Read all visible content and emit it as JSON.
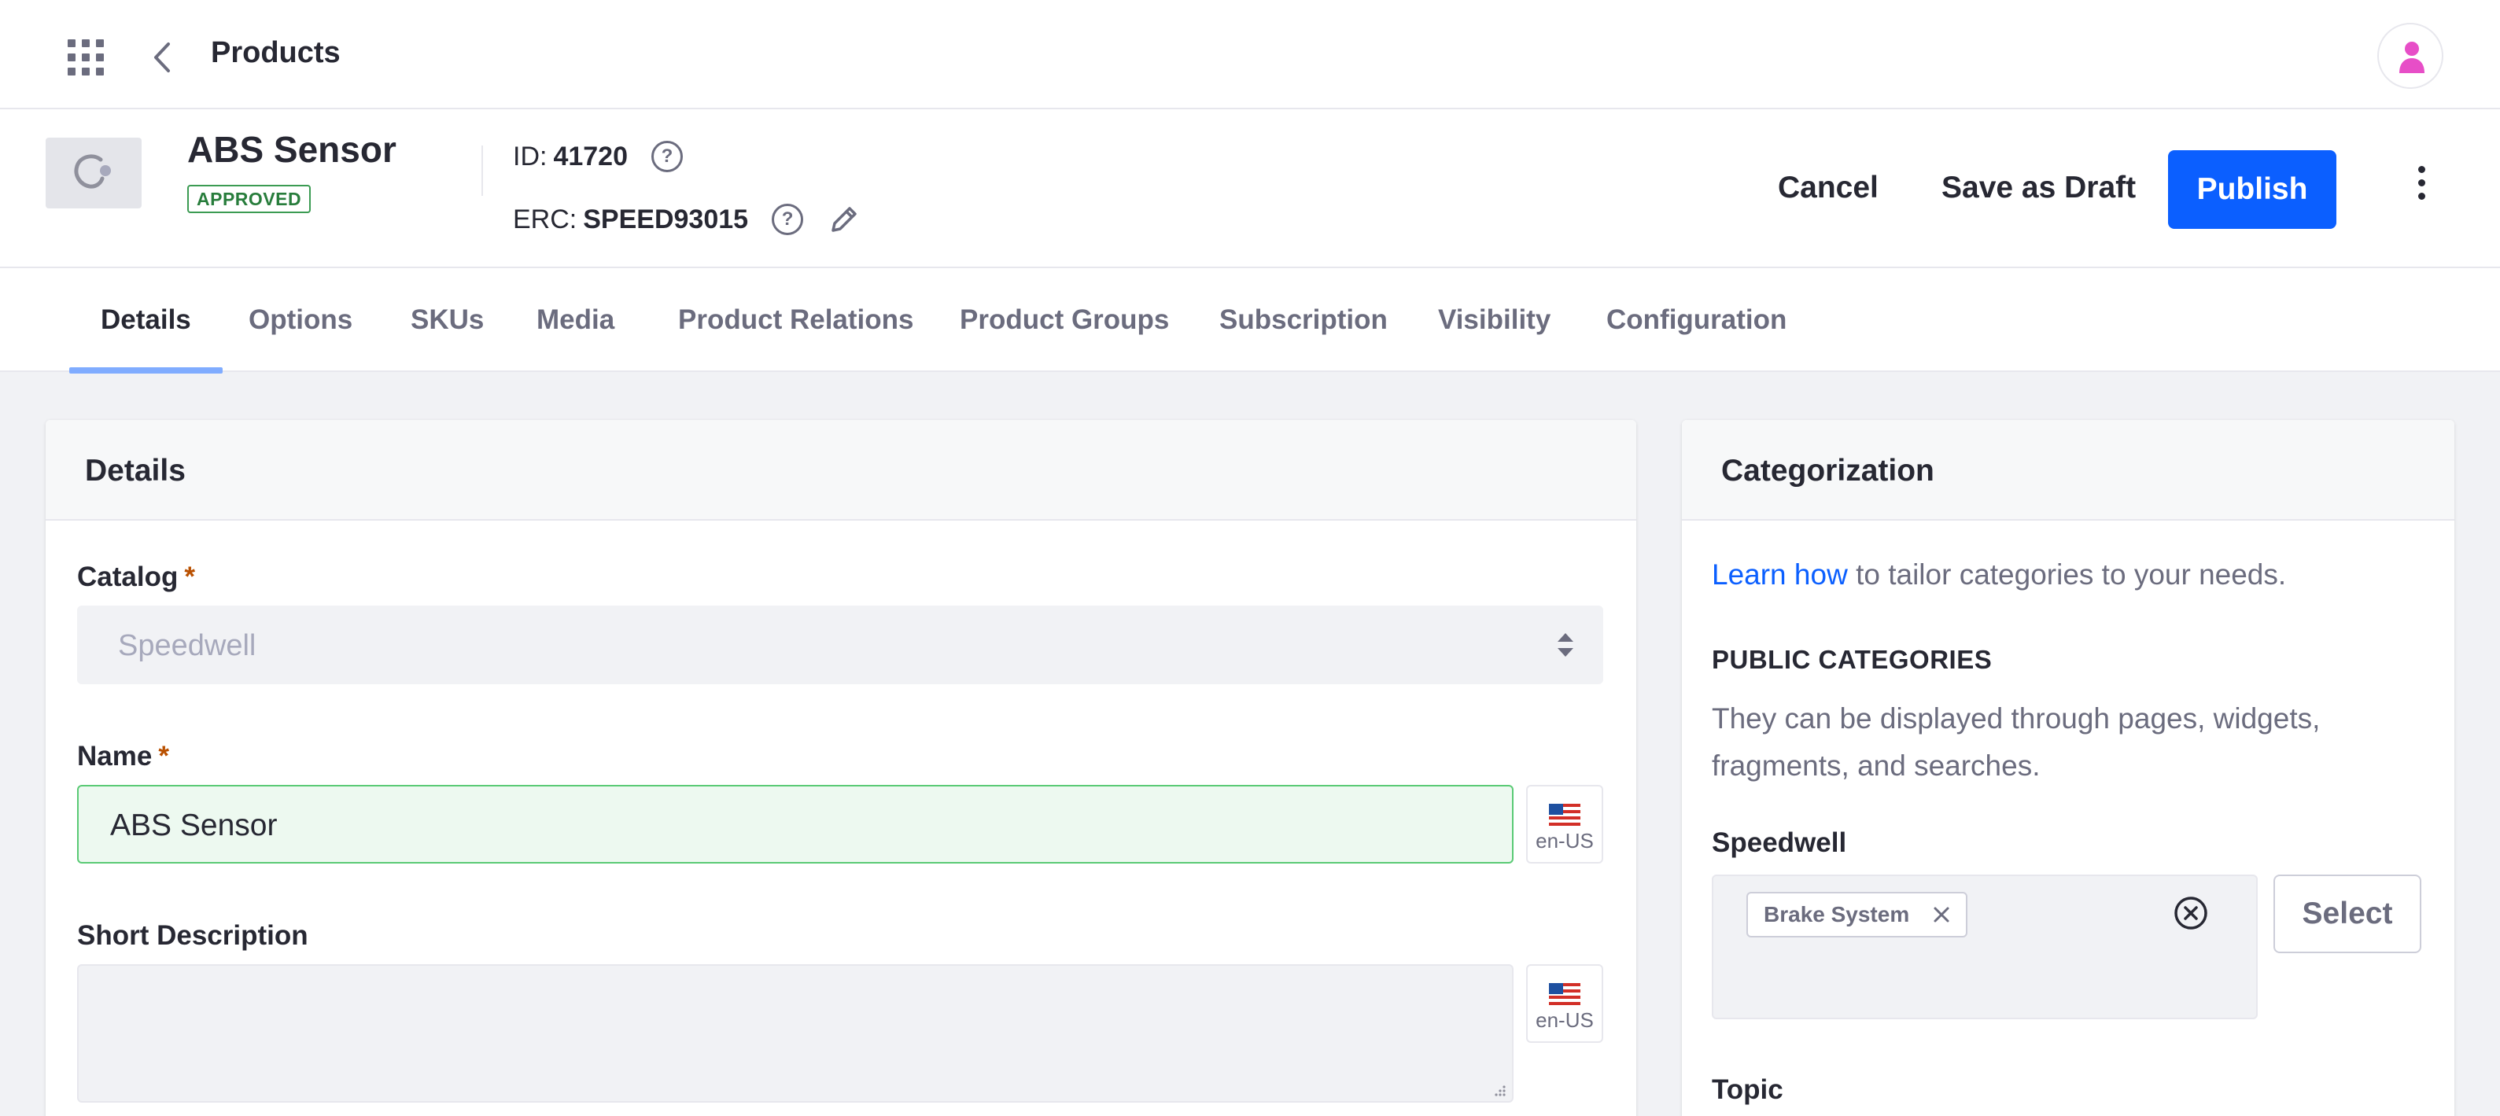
{
  "topbar": {
    "title": "Products"
  },
  "header": {
    "product_name": "ABS Sensor",
    "status": "APPROVED",
    "id_label": "ID:",
    "id_value": "41720",
    "erc_label": "ERC:",
    "erc_value": "SPEED93015",
    "cancel_label": "Cancel",
    "draft_label": "Save as Draft",
    "publish_label": "Publish"
  },
  "tabs": [
    {
      "label": "Details",
      "active": true
    },
    {
      "label": "Options"
    },
    {
      "label": "SKUs"
    },
    {
      "label": "Media"
    },
    {
      "label": "Product Relations"
    },
    {
      "label": "Product Groups"
    },
    {
      "label": "Subscription"
    },
    {
      "label": "Visibility"
    },
    {
      "label": "Configuration"
    }
  ],
  "details": {
    "title": "Details",
    "catalog_label": "Catalog",
    "catalog_value": "Speedwell",
    "name_label": "Name",
    "name_value": "ABS Sensor",
    "name_locale": "en-US",
    "short_desc_label": "Short Description",
    "short_desc_value": "",
    "short_desc_locale": "en-US",
    "required_mark": "*"
  },
  "categorization": {
    "title": "Categorization",
    "learn_link": "Learn how",
    "learn_rest": " to tailor categories to your needs.",
    "public_heading": "PUBLIC CATEGORIES",
    "public_desc": "They can be displayed through pages, widgets, fragments, and searches.",
    "vocab_label": "Speedwell",
    "tags": [
      "Brake System"
    ],
    "select_label": "Select",
    "topic_label": "Topic"
  },
  "colors": {
    "primary": "#0b5fff",
    "approved": "#287d3c",
    "valid_bg": "#edf9f0",
    "valid_border": "#5aca75",
    "avatar": "#e74ec7"
  }
}
